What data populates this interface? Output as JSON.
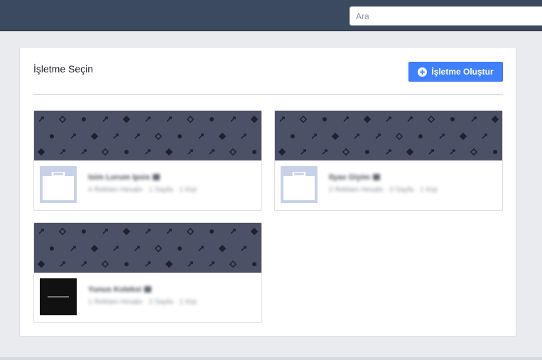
{
  "header": {
    "search_placeholder": "Ara"
  },
  "main": {
    "title": "İşletme Seçin",
    "create_button_label": "İşletme Oluştur"
  },
  "businesses": [
    {
      "name": "Isim Lorum Ipsis",
      "meta": "4 Reklam Hesabı · 1 Sayfa · 1 Kişi",
      "thumb": "briefcase-icon"
    },
    {
      "name": "Ilyas Giyim",
      "meta": "2 Reklam Hesabı · 0 Sayfa · 1 Kişi",
      "thumb": "briefcase-icon"
    },
    {
      "name": "Yunus Koleksi",
      "meta": "1 Reklam Hesabı · 2 Sayfa · 1 Kişi",
      "thumb": "custom-logo"
    }
  ],
  "colors": {
    "topbar": "#3b4a5e",
    "accent": "#4080ff",
    "cover": "#4b5167",
    "background": "#e9ebee"
  }
}
